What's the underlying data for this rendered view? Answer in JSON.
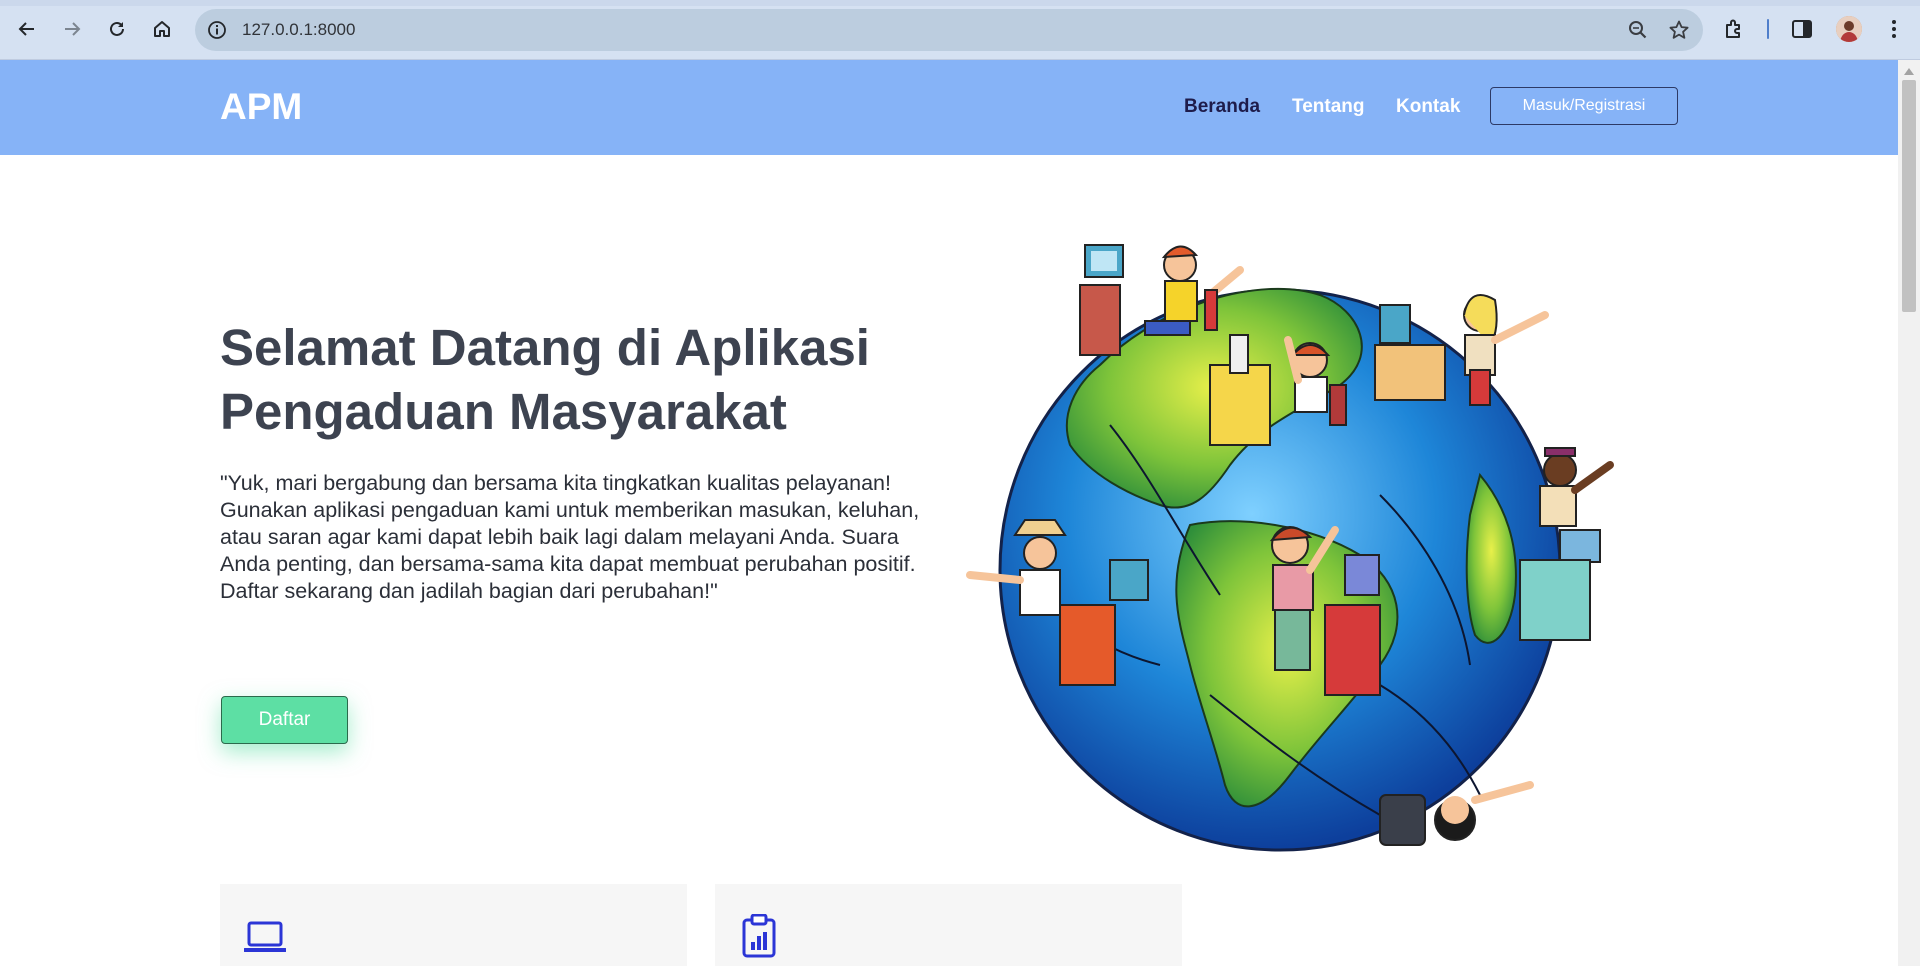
{
  "browser": {
    "url": "127.0.0.1:8000",
    "icons": [
      "back-arrow-icon",
      "forward-arrow-icon",
      "reload-icon",
      "home-icon",
      "site-info-icon",
      "zoom-icon",
      "bookmark-star-icon",
      "extensions-icon",
      "side-panel-icon",
      "profile-avatar",
      "kebab-menu-icon"
    ]
  },
  "header": {
    "brand": "APM",
    "nav": [
      {
        "label": "Beranda",
        "active": true
      },
      {
        "label": "Tentang",
        "active": false
      },
      {
        "label": "Kontak",
        "active": false
      }
    ],
    "login_button": "Masuk/Registrasi",
    "background_color": "#86b3f7"
  },
  "hero": {
    "title": "Selamat Datang di Aplikasi Pengaduan Masyarakat",
    "description": "\"Yuk, mari bergabung dan bersama kita tingkatkan kualitas pelayanan! Gunakan aplikasi pengaduan kami untuk memberikan masukan, keluhan, atau saran agar kami dapat lebih baik lagi dalam melayani Anda. Suara Anda penting, dan bersama-sama kita dapat membuat perubahan positif. Daftar sekarang dan jadilah bagian dari perubahan!\"",
    "cta_button": "Daftar",
    "cta_color": "#5ddfa4",
    "illustration": "globe-with-people-at-computers"
  },
  "features": [
    {
      "icon": "laptop-icon"
    },
    {
      "icon": "clipboard-chart-icon"
    }
  ],
  "colors": {
    "icon_accent": "#2b35d6",
    "title_text": "#3d4350"
  }
}
